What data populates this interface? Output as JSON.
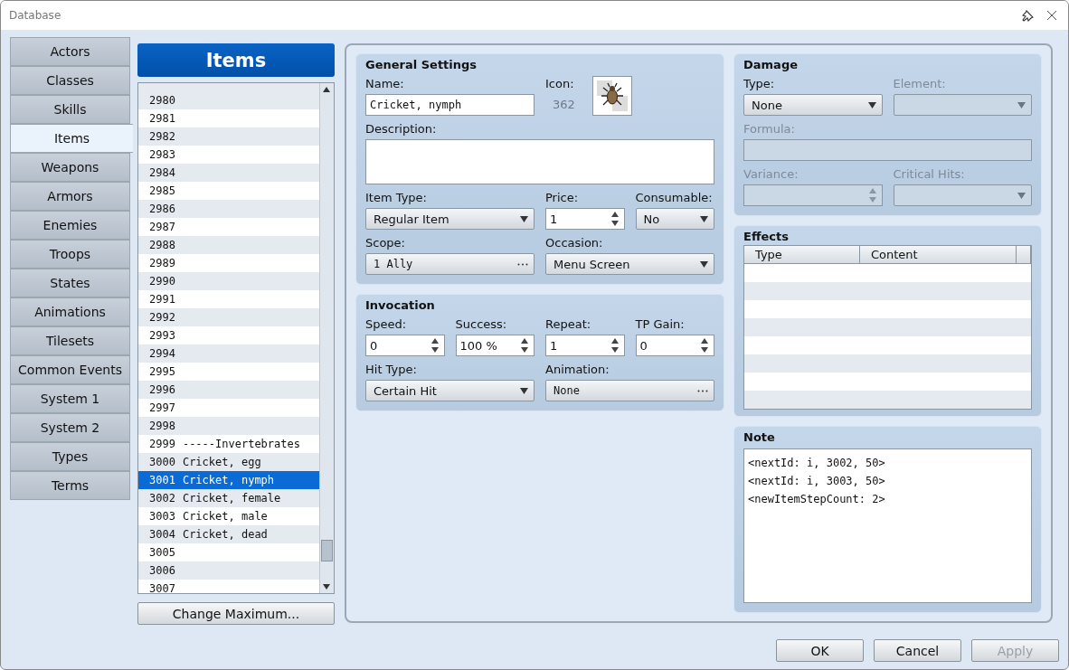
{
  "window": {
    "title": "Database"
  },
  "tabs": [
    {
      "label": "Actors",
      "selected": false
    },
    {
      "label": "Classes",
      "selected": false
    },
    {
      "label": "Skills",
      "selected": false
    },
    {
      "label": "Items",
      "selected": true
    },
    {
      "label": "Weapons",
      "selected": false
    },
    {
      "label": "Armors",
      "selected": false
    },
    {
      "label": "Enemies",
      "selected": false
    },
    {
      "label": "Troops",
      "selected": false
    },
    {
      "label": "States",
      "selected": false
    },
    {
      "label": "Animations",
      "selected": false
    },
    {
      "label": "Tilesets",
      "selected": false
    },
    {
      "label": "Common Events",
      "selected": false
    },
    {
      "label": "System 1",
      "selected": false
    },
    {
      "label": "System 2",
      "selected": false
    },
    {
      "label": "Types",
      "selected": false
    },
    {
      "label": "Terms",
      "selected": false
    }
  ],
  "list": {
    "title": "Items",
    "rows": [
      {
        "id": "2980",
        "selected": false
      },
      {
        "id": "2981",
        "selected": false
      },
      {
        "id": "2982",
        "selected": false
      },
      {
        "id": "2983",
        "selected": false
      },
      {
        "id": "2984",
        "selected": false
      },
      {
        "id": "2985",
        "selected": false
      },
      {
        "id": "2986",
        "selected": false
      },
      {
        "id": "2987",
        "selected": false
      },
      {
        "id": "2988",
        "selected": false
      },
      {
        "id": "2989",
        "selected": false
      },
      {
        "id": "2990",
        "selected": false
      },
      {
        "id": "2991",
        "selected": false
      },
      {
        "id": "2992",
        "selected": false
      },
      {
        "id": "2993",
        "selected": false
      },
      {
        "id": "2994",
        "selected": false
      },
      {
        "id": "2995",
        "selected": false
      },
      {
        "id": "2996",
        "selected": false
      },
      {
        "id": "2997",
        "selected": false
      },
      {
        "id": "2998",
        "selected": false
      },
      {
        "id": "2999",
        "name": "-----Invertebrates",
        "selected": false
      },
      {
        "id": "3000",
        "name": "Cricket, egg",
        "selected": false
      },
      {
        "id": "3001",
        "name": "Cricket, nymph",
        "selected": true
      },
      {
        "id": "3002",
        "name": "Cricket, female",
        "selected": false
      },
      {
        "id": "3003",
        "name": "Cricket, male",
        "selected": false
      },
      {
        "id": "3004",
        "name": "Cricket, dead",
        "selected": false
      },
      {
        "id": "3005",
        "selected": false
      },
      {
        "id": "3006",
        "selected": false
      },
      {
        "id": "3007",
        "selected": false
      }
    ],
    "button": "Change Maximum..."
  },
  "left_sections": [
    {
      "title": "General Settings",
      "rows": [
        {
          "fields": [
            {
              "kind": "text",
              "label": "Name:",
              "value": "Cricket, nymph",
              "disabled": false
            },
            {
              "kind": "icon",
              "label": "Icon:",
              "value": "362",
              "disabled": false
            }
          ]
        },
        {
          "fields": [
            {
              "kind": "textarea",
              "label": "Description:",
              "disabled": false
            }
          ]
        },
        {
          "fields": [
            {
              "kind": "select",
              "label": "Item Type:",
              "value": "Regular Item",
              "disabled": false
            },
            {
              "kind": "spin",
              "label": "Price:",
              "value": "1",
              "disabled": false
            },
            {
              "kind": "select",
              "label": "Consumable:",
              "value": "No",
              "disabled": false
            }
          ]
        },
        {
          "fields": [
            {
              "kind": "picker",
              "label": "Scope:",
              "value": "1 Ally",
              "disabled": false
            },
            {
              "kind": "select",
              "label": "Occasion:",
              "value": "Menu Screen",
              "disabled": false
            }
          ]
        }
      ]
    },
    {
      "title": "Invocation",
      "rows": [
        {
          "fields": [
            {
              "kind": "spin",
              "label": "Speed:",
              "value": "0",
              "disabled": false
            },
            {
              "kind": "spin",
              "label": "Success:",
              "value": "100 %",
              "disabled": false
            },
            {
              "kind": "spin",
              "label": "Repeat:",
              "value": "1",
              "disabled": false
            },
            {
              "kind": "spin",
              "label": "TP Gain:",
              "value": "0",
              "disabled": false
            }
          ]
        },
        {
          "fields": [
            {
              "kind": "select",
              "label": "Hit Type:",
              "value": "Certain Hit",
              "disabled": false
            },
            {
              "kind": "picker",
              "label": "Animation:",
              "value": "None",
              "disabled": false
            }
          ]
        }
      ]
    }
  ],
  "damage": {
    "title": "Damage",
    "rows": [
      {
        "fields": [
          {
            "kind": "select",
            "label": "Type:",
            "value": "None",
            "disabled": false
          },
          {
            "kind": "select",
            "label": "Element:",
            "disabled": true
          }
        ]
      },
      {
        "fields": [
          {
            "kind": "text",
            "label": "Formula:",
            "disabled": true
          }
        ]
      },
      {
        "fields": [
          {
            "kind": "spin",
            "label": "Variance:",
            "disabled": true
          },
          {
            "kind": "select",
            "label": "Critical Hits:",
            "disabled": true
          }
        ]
      }
    ]
  },
  "effects": {
    "title": "Effects",
    "columns": [
      "Type",
      "Content"
    ]
  },
  "note": {
    "title": "Note",
    "lines": [
      "<nextId: i, 3002, 50>",
      "<nextId: i, 3003, 50>",
      "<newItemStepCount: 2>"
    ]
  },
  "buttons": [
    {
      "label": "OK",
      "disabled": false
    },
    {
      "label": "Cancel",
      "disabled": false
    },
    {
      "label": "Apply",
      "disabled": true
    }
  ]
}
